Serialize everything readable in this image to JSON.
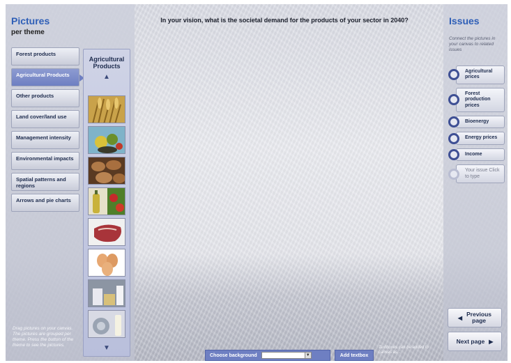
{
  "left": {
    "title": "Pictures",
    "subtitle": "per theme",
    "themes": [
      "Forest products",
      "Agricultural Products",
      "Other products",
      "Land cover/land use",
      "Management intensity",
      "Environmental impacts",
      "Spatial patterns and regions",
      "Arrows and pie charts"
    ],
    "active_theme_index": 1,
    "hint": "Drag pictures on your canvas. The pictures are grouped per theme. Press the button of the theme to see the pictures."
  },
  "strip": {
    "title": "Agricultural Products",
    "up_icon": "chevron-up-icon",
    "down_icon": "chevron-down-icon",
    "thumbs": [
      "wheat",
      "fruit-vegetables",
      "potatoes",
      "oil-peppers",
      "meat",
      "eggs",
      "dairy",
      "milk-cheese"
    ]
  },
  "question": "In your vision, what is the societal demand for the products of your sector in 2040?",
  "right": {
    "title": "Issues",
    "hint": "Connect the pictures in your canvas to related issues",
    "issues": [
      "Agricultural prices",
      "Forest production prices",
      "Bioenergy",
      "Energy prices",
      "Income"
    ],
    "placeholder_issue": "Your issue Click to type",
    "prev_label": "Previous page",
    "next_label": "Next page"
  },
  "bottom": {
    "background_label": "Choose background",
    "add_textbox_label": "Add textbox",
    "textbox_hint": "Textboxes can be added to canvas as..."
  },
  "colors": {
    "accent": "#2f5fb7",
    "button_active": "#6e7fc2",
    "issue_ring": "#3e4f94"
  }
}
